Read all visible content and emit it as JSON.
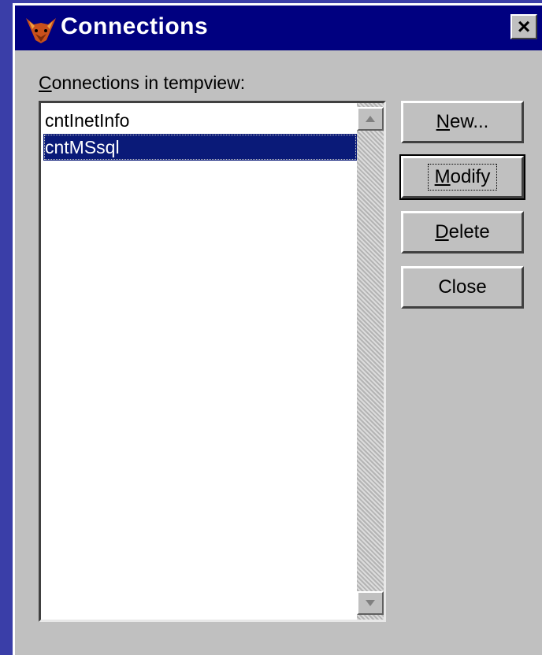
{
  "window": {
    "title": "Connections",
    "close_symbol": "×",
    "title_bar_color": "#000080",
    "app_icon": "fox-icon"
  },
  "list": {
    "label_accel": "C",
    "label_rest": "onnections in tempview:",
    "items": [
      {
        "label": "cntInetInfo",
        "selected": false
      },
      {
        "label": "cntMSsql",
        "selected": true
      }
    ],
    "selection_color": "#0a1a78"
  },
  "buttons": {
    "new_accel": "N",
    "new_rest": "ew...",
    "modify_accel": "M",
    "modify_rest": "odify",
    "delete_accel": "D",
    "delete_rest": "elete",
    "close_label": "Close"
  }
}
